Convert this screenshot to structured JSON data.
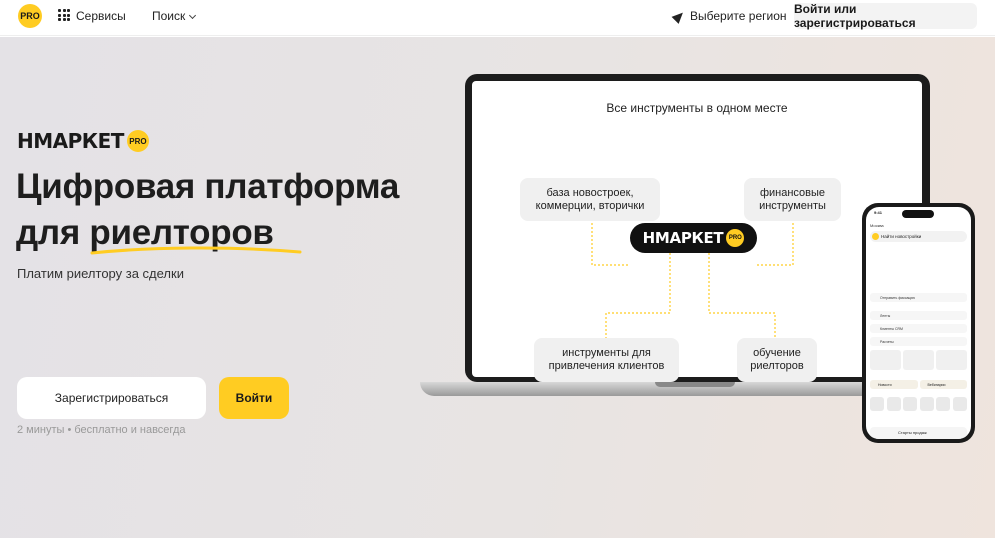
{
  "header": {
    "pro_badge": "PRO",
    "services_label": "Сервисы",
    "search_label": "Поиск",
    "region_label": "Выберите регион",
    "login_label": "Войти или зарегистрироваться"
  },
  "hero": {
    "logo_text": "НМАРКЕТ",
    "logo_pro": "PRO",
    "headline_line1": "Цифровая платформа",
    "headline_line2": "для риелторов",
    "subtext": "Платим риелтору за сделки",
    "register_label": "Зарегистрироваться",
    "enter_label": "Войти",
    "note": "2 минуты • бесплатно и навсегда"
  },
  "laptop": {
    "title": "Все инструменты в одном месте",
    "pill_db": "база новостроек, коммерции, вторички",
    "pill_finance": "финансовые инструменты",
    "pill_tools": "инструменты для привлечения клиентов",
    "pill_training": "обучение риелторов",
    "center_logo": "НМАРКЕТ",
    "center_pro": "PRO"
  },
  "phone": {
    "time": "9:41",
    "location": "Москва",
    "search": "Найти новостройки",
    "row1": "Отправить фиксацию",
    "row2": "Ленты",
    "row3": "Клиенты CRM",
    "row4": "Расчеты",
    "tag1": "Новости",
    "tag2": "Вебинарии",
    "sale": "Старты продаж"
  },
  "colors": {
    "accent": "#ffcc22",
    "dark": "#1a1a1a"
  }
}
